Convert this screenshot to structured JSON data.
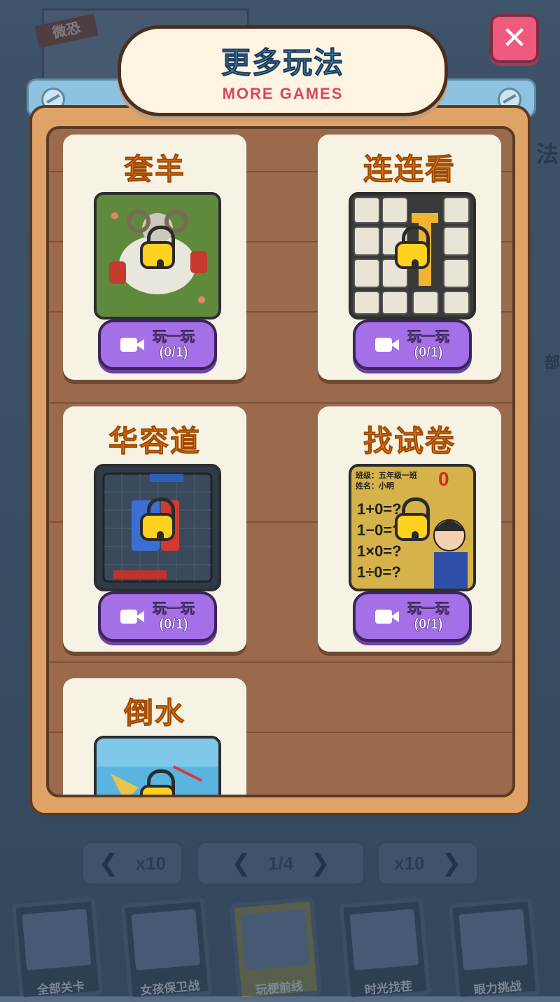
{
  "background": {
    "tag": "微恐",
    "side_text_1": "法",
    "side_text_2": "部",
    "pager": {
      "left": "x10",
      "center": "1/4",
      "right": "x10"
    },
    "chips": [
      "全部关卡",
      "女孩保卫战",
      "玩梗前线",
      "时光找茬",
      "眼力挑战"
    ]
  },
  "dialog": {
    "title_cn": "更多玩法",
    "title_en": "MORE GAMES",
    "close_icon": "✕"
  },
  "games": [
    {
      "title": "套羊",
      "play_label": "玩一玩",
      "play_count": "(0/1)",
      "thumb": "sheep"
    },
    {
      "title": "连连看",
      "play_label": "玩一玩",
      "play_count": "(0/1)",
      "thumb": "tiles"
    },
    {
      "title": "华容道",
      "play_label": "玩一玩",
      "play_count": "(0/1)",
      "thumb": "puzzle"
    },
    {
      "title": "找试卷",
      "play_label": "玩一玩",
      "play_count": "(0/1)",
      "thumb": "exam"
    },
    {
      "title": "倒水",
      "thumb": "water"
    }
  ],
  "exam_thumb": {
    "line1": "班级：五年级一班",
    "line2": "姓名：小明",
    "eq1": "1+0=?",
    "eq2": "1−0=?",
    "eq3": "1×0=?",
    "eq4": "1÷0=?",
    "score": "0"
  },
  "colors": {
    "accent_orange": "#f58a1e",
    "button_purple": "#a370e8",
    "close_pink": "#f05a7e",
    "title_blue": "#4fa1d8"
  }
}
